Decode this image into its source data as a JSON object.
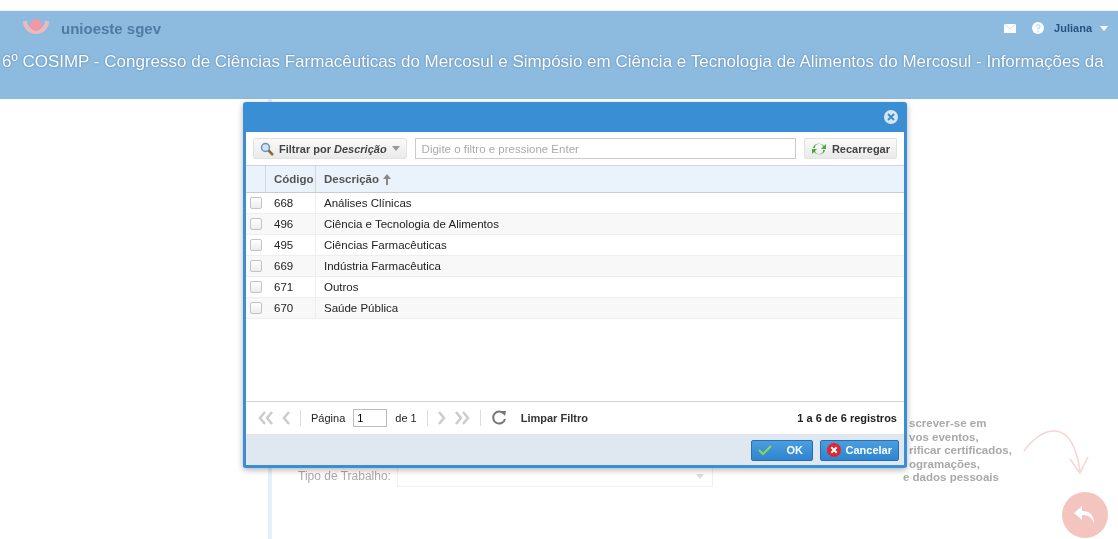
{
  "header": {
    "logo_text": "unioeste sgev",
    "user": "Juliana",
    "title": "6º COSIMP - Congresso de Ciências Farmacêuticas do Mercosul e Simpósio em Ciência e Tecnologia de Alimentos do Mercosul - Informações da"
  },
  "background": {
    "field_label": "Tipo de Trabalho:",
    "hint_lines": [
      "screver-se em",
      "vos eventos,",
      "rificar certificados,",
      "ogramações,",
      "e dados pessoais"
    ]
  },
  "dialog": {
    "filter_button": "Filtrar por *Descrição*",
    "search": {
      "placeholder": "Digite o filtro e pressione Enter"
    },
    "reload_button": "Recarregar",
    "columns": [
      "Código",
      "Descrição"
    ],
    "rows": [
      {
        "code": "668",
        "description": "Análises Clínicas",
        "checked": false
      },
      {
        "code": "496",
        "description": "Ciência e Tecnologia de Alimentos",
        "checked": false
      },
      {
        "code": "495",
        "description": "Ciências Farmacêuticas",
        "checked": false
      },
      {
        "code": "669",
        "description": "Indústria Farmacêutica",
        "checked": false
      },
      {
        "code": "671",
        "description": "Outros",
        "checked": false
      },
      {
        "code": "670",
        "description": "Saúde Pública",
        "checked": false
      }
    ],
    "pager": {
      "page_label": "Página",
      "page": "1",
      "of": "de 1",
      "clear_filter": "Limpar Filtro",
      "summary": "1 a 6 de 6 registros"
    },
    "buttons": {
      "ok": "OK",
      "cancel": "Cancelar"
    }
  }
}
